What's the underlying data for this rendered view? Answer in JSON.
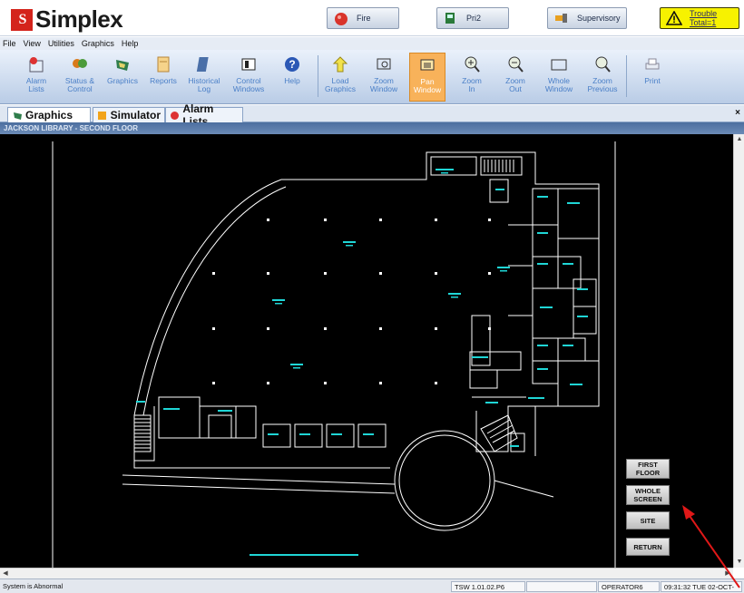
{
  "app": {
    "logo_mark": "S",
    "logo_text": "Simplex"
  },
  "alarms": [
    {
      "label": "Fire",
      "icon": "fire-icon"
    },
    {
      "label": "Pri2",
      "icon": "pri2-icon"
    },
    {
      "label": "Supervisory",
      "icon": "supervisory-icon"
    }
  ],
  "trouble": {
    "line1": "Trouble",
    "line2": "Total=1",
    "icon": "warning-triangle-icon",
    "color": "#f7f200"
  },
  "menu": [
    "File",
    "View",
    "Utilities",
    "Graphics",
    "Help"
  ],
  "toolbar": [
    {
      "label": "Alarm\nLists",
      "icon": "alarm-lists-icon"
    },
    {
      "label": "Status &\nControl",
      "icon": "status-control-icon"
    },
    {
      "label": "Graphics",
      "icon": "graphics-icon"
    },
    {
      "label": "Reports",
      "icon": "reports-icon"
    },
    {
      "label": "Historical\nLog",
      "icon": "historical-log-icon"
    },
    {
      "label": "Control\nWindows",
      "icon": "control-windows-icon"
    },
    {
      "label": "Help",
      "icon": "help-icon"
    },
    {
      "label": "Load\nGraphics",
      "icon": "load-graphics-icon"
    },
    {
      "label": "Zoom\nWindow",
      "icon": "zoom-window-icon"
    },
    {
      "label": "Pan\nWindow",
      "icon": "pan-window-icon",
      "active": true
    },
    {
      "label": "Zoom\nIn",
      "icon": "zoom-in-icon"
    },
    {
      "label": "Zoom\nOut",
      "icon": "zoom-out-icon"
    },
    {
      "label": "Whole\nWindow",
      "icon": "whole-window-icon"
    },
    {
      "label": "Zoom\nPrevious",
      "icon": "zoom-previous-icon"
    },
    {
      "label": "Print",
      "icon": "print-icon"
    }
  ],
  "tabs": [
    {
      "label": "Graphics",
      "icon": "graphics-tab-icon"
    },
    {
      "label": "Simulator",
      "icon": "simulator-tab-icon"
    },
    {
      "label": "Alarm Lists",
      "icon": "alarm-lists-tab-icon"
    }
  ],
  "graphic_title": "JACKSON LIBRARY - SECOND FLOOR",
  "nav_buttons": [
    {
      "label": "FIRST\nFLOOR"
    },
    {
      "label": "WHOLE\nSCREEN"
    },
    {
      "label": "SITE"
    },
    {
      "label": "RETURN"
    }
  ],
  "status": {
    "message": "System is Abnormal",
    "version": "TSW 1.01.02.P6",
    "empty": "",
    "operator": "OPERATOR6",
    "datetime": "09:31:32 TUE 02-OCT-07"
  },
  "colors": {
    "accent": "#f8b25a",
    "plan_lines": "#ffffff",
    "room_labels": "#1fd6d6",
    "annotation": "#e01818"
  }
}
